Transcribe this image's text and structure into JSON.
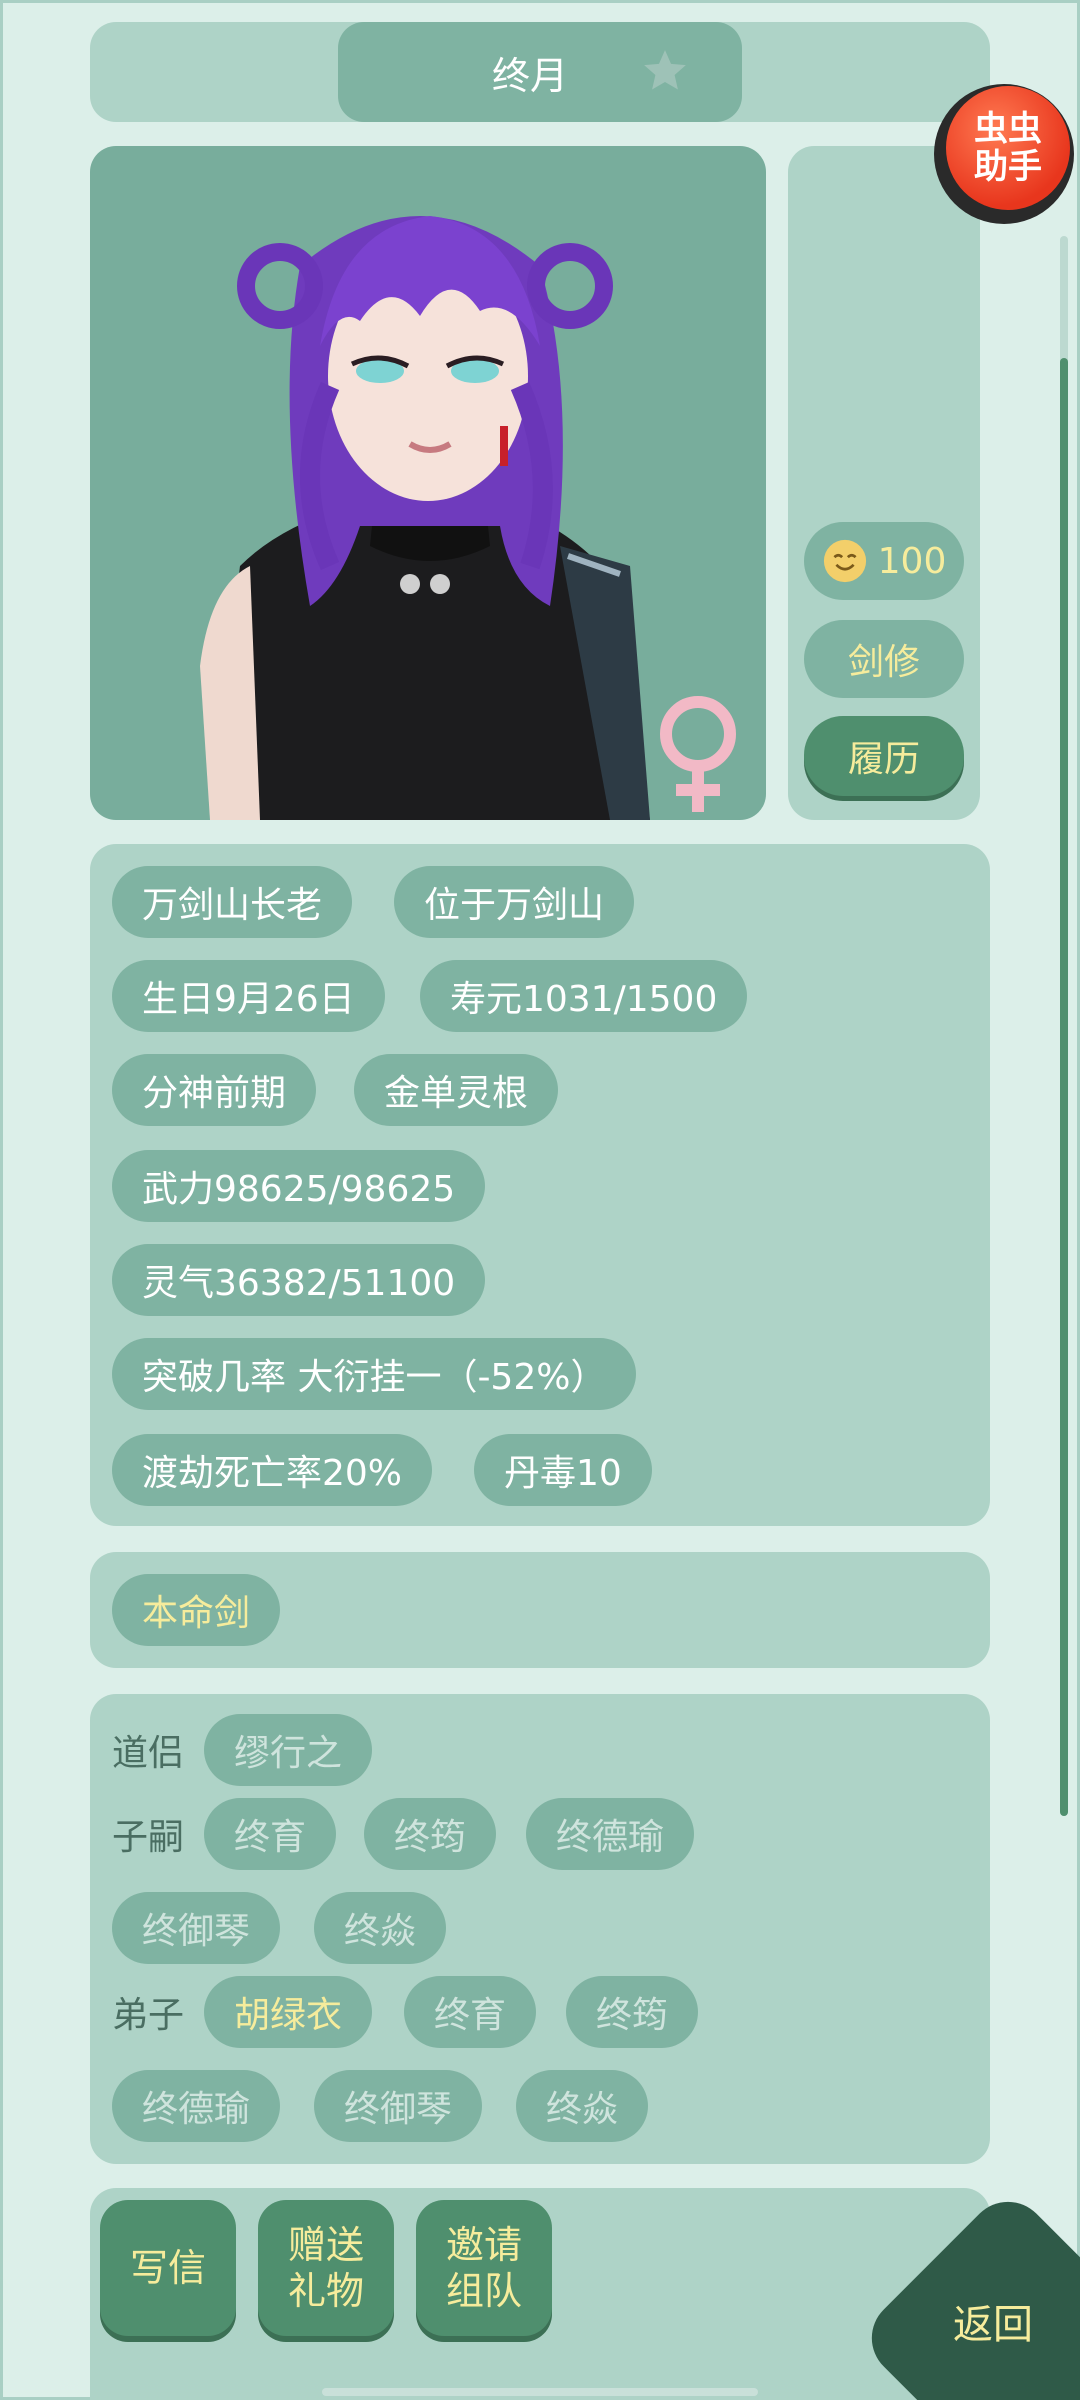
{
  "header": {
    "name": "终月",
    "star_icon": "star-icon"
  },
  "helper": {
    "line1": "虫虫",
    "line2": "助手"
  },
  "side": {
    "mood_value": "100",
    "mood_icon": "smile-face-icon",
    "class_label": "剑修",
    "resume_label": "履历",
    "gender_icon": "female-symbol-icon"
  },
  "info_tags": [
    "万剑山长老",
    "位于万剑山",
    "生日9月26日",
    "寿元1031/1500",
    "分神前期",
    "金单灵根",
    "武力98625/98625",
    "灵气36382/51100",
    "突破几率 大衍挂一（-52%）",
    "渡劫死亡率20%",
    "丹毒10"
  ],
  "sword": {
    "label": "本命剑"
  },
  "relations": {
    "partner_label": "道侣",
    "partner": [
      "缪行之"
    ],
    "children_label": "子嗣",
    "children": [
      "终育",
      "终筠",
      "终德瑜",
      "终御琴",
      "终焱"
    ],
    "disciples_label": "弟子",
    "disciples": [
      "胡绿衣",
      "终育",
      "终筠",
      "终德瑜",
      "终御琴",
      "终焱"
    ]
  },
  "actions": {
    "write_letter": "写信",
    "gift_line1": "赠送",
    "gift_line2": "礼物",
    "invite_line1": "邀请",
    "invite_line2": "组队",
    "back": "返回"
  },
  "colors": {
    "background": "#dcefe9",
    "panel": "#aed3c7",
    "pill": "#7fb3a2",
    "button": "#4f8f6e",
    "accent_text": "#f6ec9c",
    "back_button": "#2f5a48"
  }
}
